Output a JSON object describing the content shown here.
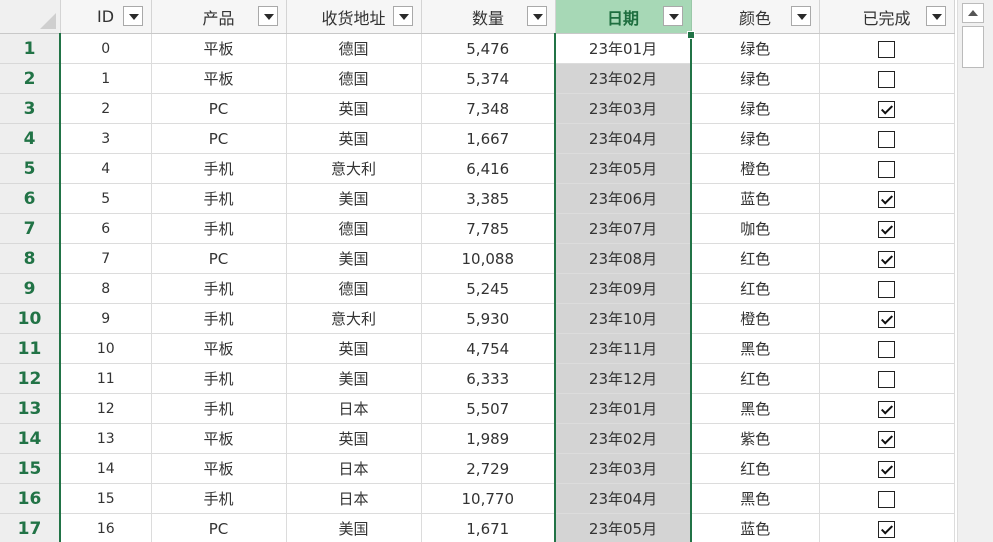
{
  "columns": [
    {
      "key": "id",
      "label": "ID"
    },
    {
      "key": "product",
      "label": "产品"
    },
    {
      "key": "address",
      "label": "收货地址"
    },
    {
      "key": "qty",
      "label": "数量"
    },
    {
      "key": "date",
      "label": "日期"
    },
    {
      "key": "color",
      "label": "颜色"
    },
    {
      "key": "done",
      "label": "已完成"
    }
  ],
  "rows": [
    {
      "n": "1",
      "id": "0",
      "product": "平板",
      "address": "德国",
      "qty": "5,476",
      "date": "23年01月",
      "color": "绿色",
      "done": false
    },
    {
      "n": "2",
      "id": "1",
      "product": "平板",
      "address": "德国",
      "qty": "5,374",
      "date": "23年02月",
      "color": "绿色",
      "done": false
    },
    {
      "n": "3",
      "id": "2",
      "product": "PC",
      "address": "英国",
      "qty": "7,348",
      "date": "23年03月",
      "color": "绿色",
      "done": true
    },
    {
      "n": "4",
      "id": "3",
      "product": "PC",
      "address": "英国",
      "qty": "1,667",
      "date": "23年04月",
      "color": "绿色",
      "done": false
    },
    {
      "n": "5",
      "id": "4",
      "product": "手机",
      "address": "意大利",
      "qty": "6,416",
      "date": "23年05月",
      "color": "橙色",
      "done": false
    },
    {
      "n": "6",
      "id": "5",
      "product": "手机",
      "address": "美国",
      "qty": "3,385",
      "date": "23年06月",
      "color": "蓝色",
      "done": true
    },
    {
      "n": "7",
      "id": "6",
      "product": "手机",
      "address": "德国",
      "qty": "7,785",
      "date": "23年07月",
      "color": "咖色",
      "done": true
    },
    {
      "n": "8",
      "id": "7",
      "product": "PC",
      "address": "美国",
      "qty": "10,088",
      "date": "23年08月",
      "color": "红色",
      "done": true
    },
    {
      "n": "9",
      "id": "8",
      "product": "手机",
      "address": "德国",
      "qty": "5,245",
      "date": "23年09月",
      "color": "红色",
      "done": false
    },
    {
      "n": "10",
      "id": "9",
      "product": "手机",
      "address": "意大利",
      "qty": "5,930",
      "date": "23年10月",
      "color": "橙色",
      "done": true
    },
    {
      "n": "11",
      "id": "10",
      "product": "平板",
      "address": "英国",
      "qty": "4,754",
      "date": "23年11月",
      "color": "黑色",
      "done": false
    },
    {
      "n": "12",
      "id": "11",
      "product": "手机",
      "address": "美国",
      "qty": "6,333",
      "date": "23年12月",
      "color": "红色",
      "done": false
    },
    {
      "n": "13",
      "id": "12",
      "product": "手机",
      "address": "日本",
      "qty": "5,507",
      "date": "23年01月",
      "color": "黑色",
      "done": true
    },
    {
      "n": "14",
      "id": "13",
      "product": "平板",
      "address": "英国",
      "qty": "1,989",
      "date": "23年02月",
      "color": "紫色",
      "done": true
    },
    {
      "n": "15",
      "id": "14",
      "product": "平板",
      "address": "日本",
      "qty": "2,729",
      "date": "23年03月",
      "color": "红色",
      "done": true
    },
    {
      "n": "16",
      "id": "15",
      "product": "手机",
      "address": "日本",
      "qty": "10,770",
      "date": "23年04月",
      "color": "黑色",
      "done": false
    },
    {
      "n": "17",
      "id": "16",
      "product": "PC",
      "address": "美国",
      "qty": "1,671",
      "date": "23年05月",
      "color": "蓝色",
      "done": true
    }
  ]
}
